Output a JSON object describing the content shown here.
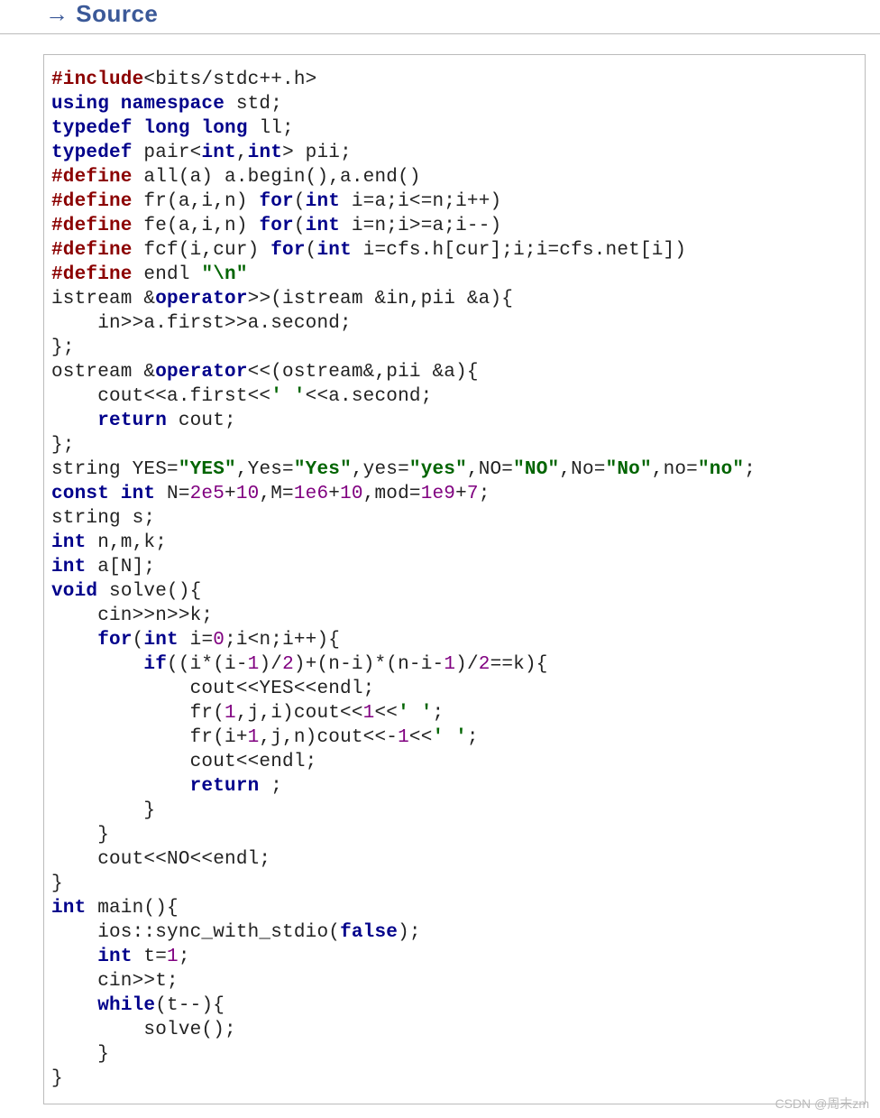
{
  "header": "→ Source",
  "watermark": "CSDN @周末zm",
  "code": {
    "tokens": [
      [
        [
          "c-preproc",
          "#include"
        ],
        [
          "c-plain",
          "<bits/stdc++.h>"
        ]
      ],
      [
        [
          "c-kw",
          "using namespace"
        ],
        [
          "c-plain",
          " std;"
        ]
      ],
      [
        [
          "c-kw",
          "typedef long long"
        ],
        [
          "c-plain",
          " ll;"
        ]
      ],
      [
        [
          "c-kw",
          "typedef"
        ],
        [
          "c-plain",
          " pair<"
        ],
        [
          "c-kw",
          "int"
        ],
        [
          "c-plain",
          ","
        ],
        [
          "c-kw",
          "int"
        ],
        [
          "c-plain",
          "> pii;"
        ]
      ],
      [
        [
          "c-preproc",
          "#define"
        ],
        [
          "c-plain",
          " all(a) a.begin(),a.end()"
        ]
      ],
      [
        [
          "c-preproc",
          "#define"
        ],
        [
          "c-plain",
          " fr(a,i,n) "
        ],
        [
          "c-kw",
          "for"
        ],
        [
          "c-plain",
          "("
        ],
        [
          "c-kw",
          "int"
        ],
        [
          "c-plain",
          " i=a;i<=n;i++)"
        ]
      ],
      [
        [
          "c-preproc",
          "#define"
        ],
        [
          "c-plain",
          " fe(a,i,n) "
        ],
        [
          "c-kw",
          "for"
        ],
        [
          "c-plain",
          "("
        ],
        [
          "c-kw",
          "int"
        ],
        [
          "c-plain",
          " i=n;i>=a;i--)"
        ]
      ],
      [
        [
          "c-preproc",
          "#define"
        ],
        [
          "c-plain",
          " fcf(i,cur) "
        ],
        [
          "c-kw",
          "for"
        ],
        [
          "c-plain",
          "("
        ],
        [
          "c-kw",
          "int"
        ],
        [
          "c-plain",
          " i=cfs.h[cur];i;i=cfs.net[i])"
        ]
      ],
      [
        [
          "c-preproc",
          "#define"
        ],
        [
          "c-plain",
          " endl "
        ],
        [
          "c-str",
          "\"\\n\""
        ]
      ],
      [
        [
          "c-plain",
          "istream &"
        ],
        [
          "c-kw",
          "operator"
        ],
        [
          "c-plain",
          ">>(istream &in,pii &a){"
        ]
      ],
      [
        [
          "c-plain",
          "    in>>a.first>>a.second;"
        ]
      ],
      [
        [
          "c-plain",
          "};"
        ]
      ],
      [
        [
          "c-plain",
          "ostream &"
        ],
        [
          "c-kw",
          "operator"
        ],
        [
          "c-plain",
          "<<(ostream&,pii &a){"
        ]
      ],
      [
        [
          "c-plain",
          "    cout<<a.first<<"
        ],
        [
          "c-str",
          "' '"
        ],
        [
          "c-plain",
          "<<a.second;"
        ]
      ],
      [
        [
          "c-plain",
          "    "
        ],
        [
          "c-kw",
          "return"
        ],
        [
          "c-plain",
          " cout;"
        ]
      ],
      [
        [
          "c-plain",
          "};"
        ]
      ],
      [
        [
          "c-plain",
          "string YES="
        ],
        [
          "c-str",
          "\"YES\""
        ],
        [
          "c-plain",
          ",Yes="
        ],
        [
          "c-str",
          "\"Yes\""
        ],
        [
          "c-plain",
          ",yes="
        ],
        [
          "c-str",
          "\"yes\""
        ],
        [
          "c-plain",
          ",NO="
        ],
        [
          "c-str",
          "\"NO\""
        ],
        [
          "c-plain",
          ",No="
        ],
        [
          "c-str",
          "\"No\""
        ],
        [
          "c-plain",
          ",no="
        ],
        [
          "c-str",
          "\"no\""
        ],
        [
          "c-plain",
          ";"
        ]
      ],
      [
        [
          "c-kw",
          "const int"
        ],
        [
          "c-plain",
          " N="
        ],
        [
          "c-num",
          "2e5"
        ],
        [
          "c-plain",
          "+"
        ],
        [
          "c-num",
          "10"
        ],
        [
          "c-plain",
          ",M="
        ],
        [
          "c-num",
          "1e6"
        ],
        [
          "c-plain",
          "+"
        ],
        [
          "c-num",
          "10"
        ],
        [
          "c-plain",
          ",mod="
        ],
        [
          "c-num",
          "1e9"
        ],
        [
          "c-plain",
          "+"
        ],
        [
          "c-num",
          "7"
        ],
        [
          "c-plain",
          ";"
        ]
      ],
      [
        [
          "c-plain",
          "string s;"
        ]
      ],
      [
        [
          "c-kw",
          "int"
        ],
        [
          "c-plain",
          " n,m,k;"
        ]
      ],
      [
        [
          "c-kw",
          "int"
        ],
        [
          "c-plain",
          " a[N];"
        ]
      ],
      [
        [
          "c-kw",
          "void"
        ],
        [
          "c-plain",
          " solve(){"
        ]
      ],
      [
        [
          "c-plain",
          "    cin>>n>>k;"
        ]
      ],
      [
        [
          "c-plain",
          "    "
        ],
        [
          "c-kw",
          "for"
        ],
        [
          "c-plain",
          "("
        ],
        [
          "c-kw",
          "int"
        ],
        [
          "c-plain",
          " i="
        ],
        [
          "c-num",
          "0"
        ],
        [
          "c-plain",
          ";i<n;i++){"
        ]
      ],
      [
        [
          "c-plain",
          "        "
        ],
        [
          "c-kw",
          "if"
        ],
        [
          "c-plain",
          "((i*(i-"
        ],
        [
          "c-num",
          "1"
        ],
        [
          "c-plain",
          ")/"
        ],
        [
          "c-num",
          "2"
        ],
        [
          "c-plain",
          ")+(n-i)*(n-i-"
        ],
        [
          "c-num",
          "1"
        ],
        [
          "c-plain",
          ")/"
        ],
        [
          "c-num",
          "2"
        ],
        [
          "c-plain",
          "==k){"
        ]
      ],
      [
        [
          "c-plain",
          "            cout<<YES<<endl;"
        ]
      ],
      [
        [
          "c-plain",
          "            fr("
        ],
        [
          "c-num",
          "1"
        ],
        [
          "c-plain",
          ",j,i)cout<<"
        ],
        [
          "c-num",
          "1"
        ],
        [
          "c-plain",
          "<<"
        ],
        [
          "c-str",
          "' '"
        ],
        [
          "c-plain",
          ";"
        ]
      ],
      [
        [
          "c-plain",
          "            fr(i+"
        ],
        [
          "c-num",
          "1"
        ],
        [
          "c-plain",
          ",j,n)cout<<-"
        ],
        [
          "c-num",
          "1"
        ],
        [
          "c-plain",
          "<<"
        ],
        [
          "c-str",
          "' '"
        ],
        [
          "c-plain",
          ";"
        ]
      ],
      [
        [
          "c-plain",
          "            cout<<endl;"
        ]
      ],
      [
        [
          "c-plain",
          "            "
        ],
        [
          "c-kw",
          "return"
        ],
        [
          "c-plain",
          " ;"
        ]
      ],
      [
        [
          "c-plain",
          "        }"
        ]
      ],
      [
        [
          "c-plain",
          "    }"
        ]
      ],
      [
        [
          "c-plain",
          "    cout<<NO<<endl;"
        ]
      ],
      [
        [
          "c-plain",
          "}"
        ]
      ],
      [
        [
          "c-kw",
          "int"
        ],
        [
          "c-plain",
          " main(){"
        ]
      ],
      [
        [
          "c-plain",
          "    ios::sync_with_stdio("
        ],
        [
          "c-kw",
          "false"
        ],
        [
          "c-plain",
          ");"
        ]
      ],
      [
        [
          "c-plain",
          "    "
        ],
        [
          "c-kw",
          "int"
        ],
        [
          "c-plain",
          " t="
        ],
        [
          "c-num",
          "1"
        ],
        [
          "c-plain",
          ";"
        ]
      ],
      [
        [
          "c-plain",
          "    cin>>t;"
        ]
      ],
      [
        [
          "c-plain",
          "    "
        ],
        [
          "c-kw",
          "while"
        ],
        [
          "c-plain",
          "(t--){"
        ]
      ],
      [
        [
          "c-plain",
          "        solve();"
        ]
      ],
      [
        [
          "c-plain",
          "    }"
        ]
      ],
      [
        [
          "c-plain",
          "}"
        ]
      ]
    ]
  }
}
